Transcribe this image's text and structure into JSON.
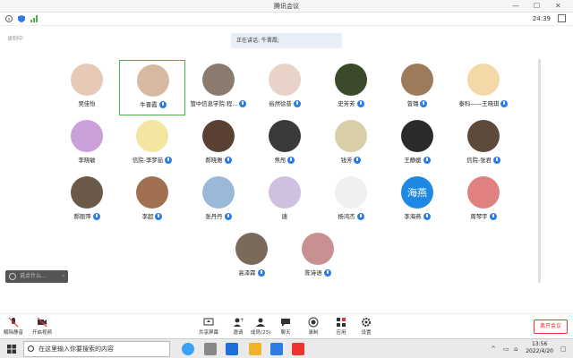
{
  "window": {
    "title": "腾讯会议"
  },
  "infobar": {
    "timer": "24:39"
  },
  "recording": "录制中",
  "speaking": "正在讲话: 牛晋霞;",
  "participants": [
    {
      "name": "吴佳怡",
      "mic": false,
      "color": "#e8c9b5",
      "active": false
    },
    {
      "name": "牛晋霞",
      "mic": true,
      "color": "#d7b8a0",
      "active": true
    },
    {
      "name": "管中信息学院:程...",
      "mic": true,
      "color": "#8a7b6e",
      "active": false
    },
    {
      "name": "俗然徐昔",
      "mic": true,
      "color": "#e9d3c9",
      "active": false
    },
    {
      "name": "史芳芳",
      "mic": true,
      "color": "#3b4a2a",
      "active": false
    },
    {
      "name": "曾璐",
      "mic": true,
      "color": "#9c7a5a",
      "active": false
    },
    {
      "name": "泰科——王晓琪",
      "mic": true,
      "color": "#f4d9a8",
      "active": false
    },
    {
      "name": "李晓敏",
      "mic": false,
      "color": "#c9a0d9",
      "active": false
    },
    {
      "name": "信院-李梦茹",
      "mic": true,
      "color": "#f2e6a0",
      "active": false
    },
    {
      "name": "郝晓雅",
      "mic": true,
      "color": "#5a4032",
      "active": false
    },
    {
      "name": "焦彤",
      "mic": true,
      "color": "#3a3a3a",
      "active": false
    },
    {
      "name": "钱芳",
      "mic": true,
      "color": "#d8cfa8",
      "active": false
    },
    {
      "name": "王静媛",
      "mic": true,
      "color": "#2b2b2b",
      "active": false
    },
    {
      "name": "信院-张君",
      "mic": true,
      "color": "#5d4a3a",
      "active": false
    },
    {
      "name": "郝丽萍",
      "mic": true,
      "color": "#6b5a4a",
      "active": false
    },
    {
      "name": "李超",
      "mic": true,
      "color": "#a07050",
      "active": false
    },
    {
      "name": "张丹丹",
      "mic": true,
      "color": "#9ab8d8",
      "active": false
    },
    {
      "name": "唐",
      "mic": false,
      "color": "#d0c0e0",
      "active": false
    },
    {
      "name": "杨鸿杰",
      "mic": true,
      "color": "#f0f0f0",
      "active": false
    },
    {
      "name": "李海燕",
      "mic": true,
      "color": "#1e88e5",
      "active": false,
      "text": "海燕"
    },
    {
      "name": "周琴宇",
      "mic": true,
      "color": "#e08080",
      "active": false
    },
    {
      "name": "高泽霖",
      "mic": true,
      "color": "#7a6a5a",
      "active": false
    },
    {
      "name": "陈诗语",
      "mic": true,
      "color": "#c89090",
      "active": false
    }
  ],
  "chat": {
    "placeholder": "说点什么..."
  },
  "toolbar": {
    "mute": "解除静音",
    "video": "开启视频",
    "share": "共享屏幕",
    "invite": "邀请",
    "members": "成员(23)",
    "chat": "聊天",
    "record": "录制",
    "apps": "应用",
    "settings": "设置",
    "leave": "离开会议"
  },
  "taskbar": {
    "search": "在这里输入你要搜索的内容",
    "time": "13:56",
    "date": "2022/4/20"
  }
}
